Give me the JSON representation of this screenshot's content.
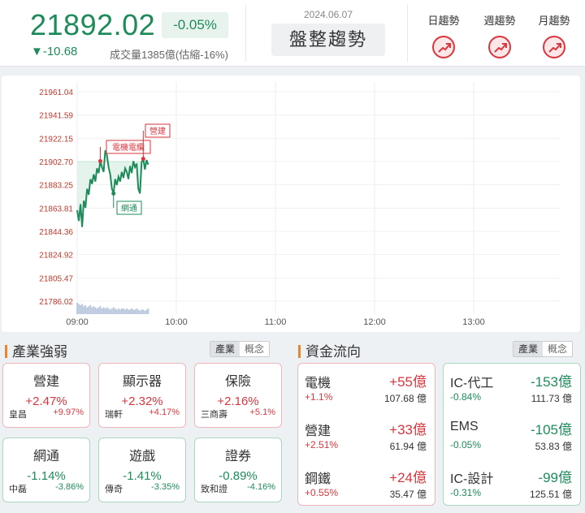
{
  "header": {
    "price": "21892.02",
    "pct": "-0.05%",
    "change": "▼-10.68",
    "volume": "成交量1385億(估縮-16%)",
    "date": "2024.06.07",
    "trend": "盤整趨勢",
    "timeframes": [
      {
        "label": "日趨勢",
        "icon": "trend-up-icon"
      },
      {
        "label": "週趨勢",
        "icon": "trend-up-icon"
      },
      {
        "label": "月趨勢",
        "icon": "trend-up-icon"
      }
    ]
  },
  "chart": {
    "y_ticks": [
      "21961.04",
      "21941.59",
      "21922.15",
      "21902.70",
      "21883.25",
      "21863.81",
      "21844.36",
      "21824.92",
      "21805.47",
      "21786.02"
    ],
    "x_ticks": [
      "09:00",
      "10:00",
      "11:00",
      "12:00",
      "13:00"
    ],
    "annotations": [
      "電機電纜",
      "營建",
      "網通"
    ],
    "colors": {
      "line": "#1d8c5a",
      "reference": "#c6e6d6",
      "marker": "#d9363e",
      "volume": "#b7c6dc"
    }
  },
  "chart_data": {
    "type": "line",
    "x_unit": "minutes after 09:00",
    "ylim": [
      21786.02,
      21961.04
    ],
    "reference": 21902.7,
    "series": [
      {
        "x": [
          0,
          1,
          2,
          3,
          4,
          5,
          6,
          7,
          8,
          9,
          10,
          11,
          12,
          13,
          14,
          15,
          16,
          17,
          18,
          19,
          20,
          21,
          22,
          23,
          24,
          25,
          26,
          27,
          28,
          29,
          30,
          31,
          32,
          33,
          34,
          35,
          36,
          37,
          38,
          39,
          40,
          41,
          42,
          43
        ],
        "y": [
          21862,
          21853,
          21867,
          21848,
          21870,
          21864,
          21880,
          21875,
          21888,
          21884,
          21892,
          21886,
          21897,
          21893,
          21903,
          21898,
          21894,
          21912,
          21908,
          21898,
          21892,
          21880,
          21876,
          21888,
          21883,
          21890,
          21886,
          21894,
          21889,
          21897,
          21894,
          21888,
          21899,
          21893,
          21903,
          21898,
          21901,
          21880,
          21876,
          21902,
          21905,
          21896,
          21904,
          21900
        ]
      }
    ],
    "volume": [
      10,
      9,
      8,
      9,
      7,
      8,
      6,
      7,
      8,
      6,
      7,
      6,
      5,
      6,
      7,
      5,
      6,
      5,
      6,
      5,
      4,
      5,
      6,
      5,
      4,
      5,
      4,
      5,
      5,
      4,
      5,
      4,
      4,
      5,
      4,
      4,
      5,
      4,
      3,
      4,
      4,
      3,
      4,
      5
    ],
    "markers": [
      {
        "x": 14,
        "label": "電機電纜"
      },
      {
        "x": 40,
        "label": "營建"
      },
      {
        "x": 22,
        "label": "網通"
      }
    ]
  },
  "industry": {
    "title": "產業強弱",
    "toggle": [
      "產業",
      "概念"
    ],
    "cards": [
      {
        "name": "營建",
        "pct": "+2.47%",
        "stock": "皇昌",
        "stock_pct": "+9.97%",
        "dir": "up"
      },
      {
        "name": "顯示器",
        "pct": "+2.32%",
        "stock": "瑞軒",
        "stock_pct": "+4.17%",
        "dir": "up"
      },
      {
        "name": "保險",
        "pct": "+2.16%",
        "stock": "三商壽",
        "stock_pct": "+5.1%",
        "dir": "up"
      },
      {
        "name": "網通",
        "pct": "-1.14%",
        "stock": "中磊",
        "stock_pct": "-3.86%",
        "dir": "down"
      },
      {
        "name": "遊戲",
        "pct": "-1.41%",
        "stock": "傳奇",
        "stock_pct": "-3.35%",
        "dir": "down"
      },
      {
        "name": "證券",
        "pct": "-0.89%",
        "stock": "致和證",
        "stock_pct": "-4.16%",
        "dir": "down"
      }
    ]
  },
  "flow": {
    "title": "資金流向",
    "toggle": [
      "產業",
      "概念"
    ],
    "inflow": [
      {
        "name": "電機",
        "amount": "+55億",
        "pct": "+1.1%",
        "value": "107.68 億"
      },
      {
        "name": "營建",
        "amount": "+33億",
        "pct": "+2.51%",
        "value": "61.94 億"
      },
      {
        "name": "鋼鐵",
        "amount": "+24億",
        "pct": "+0.55%",
        "value": "35.47 億"
      }
    ],
    "outflow": [
      {
        "name": "IC-代工",
        "amount": "-153億",
        "pct": "-0.84%",
        "value": "111.73 億"
      },
      {
        "name": "EMS",
        "amount": "-105億",
        "pct": "-0.05%",
        "value": "53.83 億"
      },
      {
        "name": "IC-設計",
        "amount": "-99億",
        "pct": "-0.31%",
        "value": "125.51 億"
      }
    ]
  }
}
